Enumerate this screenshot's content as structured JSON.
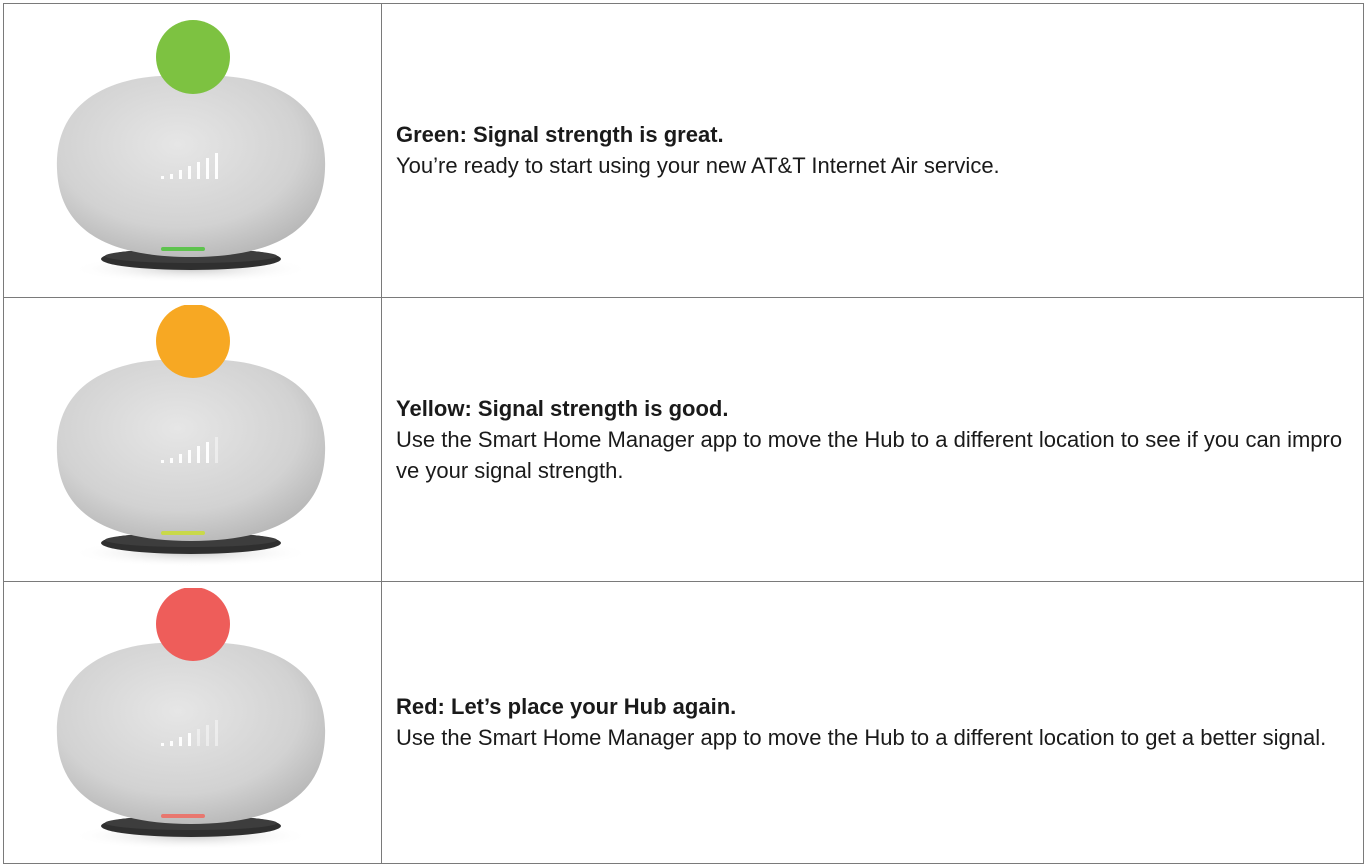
{
  "rows": [
    {
      "status_color": "#7dc241",
      "led_color": "#5ec34e",
      "bars_lit": 5,
      "title": "Green: Signal strength is great.",
      "description": "You’re ready to start using your new AT&T Internet Air service.",
      "icon": "hub-green-icon"
    },
    {
      "status_color": "#f7a823",
      "led_color": "#c9d94a",
      "bars_lit": 4,
      "title": "Yellow: Signal strength is good.",
      "description": "Use the Smart Home Manager app to move the Hub to a different location to see if you can improve your signal strength.",
      "icon": "hub-yellow-icon"
    },
    {
      "status_color": "#ee5d5a",
      "led_color": "#e8776f",
      "bars_lit": 2,
      "title": "Red: Let’s place your Hub again.",
      "description": "Use the Smart Home Manager app to move the Hub to a different location to get a better signal.",
      "icon": "hub-red-icon"
    }
  ]
}
